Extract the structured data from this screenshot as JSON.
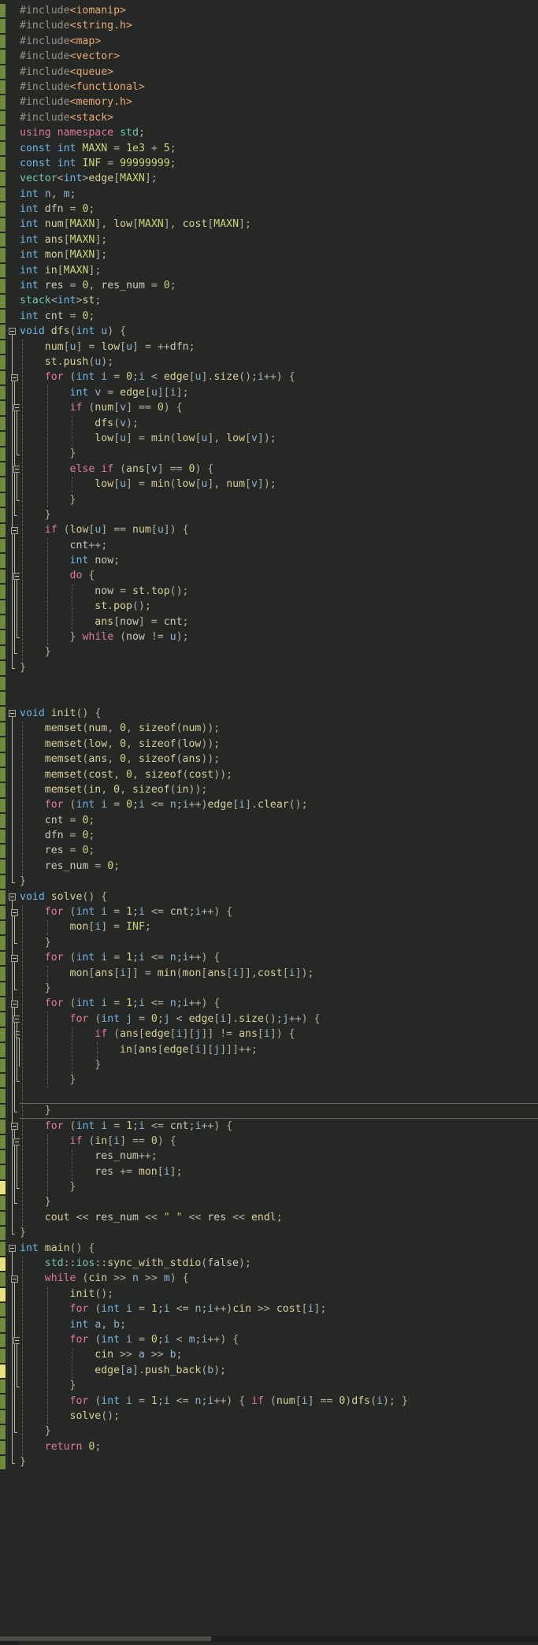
{
  "editor": {
    "name": "code-editor",
    "language": "C++",
    "background_color": "#262826",
    "gutter_color": "#262826",
    "current_line_border_color": "#6a6a64",
    "indent_guide_color": "#5a5c56",
    "change_marker_saved_color": "#6f8a3f",
    "change_marker_unsaved_color": "#e8e07a",
    "current_line_number": 72,
    "total_lines": 107
  },
  "palette": {
    "keyword": "#e0779c",
    "type": "#6fb7e8",
    "preprocessor": "#8f9488",
    "header": "#e8a877",
    "class": "#6fc8a8",
    "function": "#d9cf9a",
    "number": "#c9d67a",
    "string": "#d8c07a",
    "identifier": "#cfc8ba",
    "index": "#8fb4d4",
    "punctuation": "#b4aea2"
  },
  "code": {
    "lines": [
      "#include<iomanip>",
      "#include<string.h>",
      "#include<map>",
      "#include<vector>",
      "#include<queue>",
      "#include<functional>",
      "#include<memory.h>",
      "#include<stack>",
      "using namespace std;",
      "const int MAXN = 1e3 + 5;",
      "const int INF = 99999999;",
      "vector<int>edge[MAXN];",
      "int n, m;",
      "int dfn = 0;",
      "int num[MAXN], low[MAXN], cost[MAXN];",
      "int ans[MAXN];",
      "int mon[MAXN];",
      "int in[MAXN];",
      "int res = 0, res_num = 0;",
      "stack<int>st;",
      "int cnt = 0;",
      "void dfs(int u) {",
      "    num[u] = low[u] = ++dfn;",
      "    st.push(u);",
      "    for (int i = 0;i < edge[u].size();i++) {",
      "        int v = edge[u][i];",
      "        if (num[v] == 0) {",
      "            dfs(v);",
      "            low[u] = min(low[u], low[v]);",
      "        }",
      "        else if (ans[v] == 0) {",
      "            low[u] = min(low[u], num[v]);",
      "        }",
      "    }",
      "    if (low[u] == num[u]) {",
      "        cnt++;",
      "        int now;",
      "        do {",
      "            now = st.top();",
      "            st.pop();",
      "            ans[now] = cnt;",
      "        } while (now != u);",
      "    }",
      "}",
      "",
      "",
      "void init() {",
      "    memset(num, 0, sizeof(num));",
      "    memset(low, 0, sizeof(low));",
      "    memset(ans, 0, sizeof(ans));",
      "    memset(cost, 0, sizeof(cost));",
      "    memset(in, 0, sizeof(in));",
      "    for (int i = 0;i <= n;i++)edge[i].clear();",
      "    cnt = 0;",
      "    dfn = 0;",
      "    res = 0;",
      "    res_num = 0;",
      "}",
      "void solve() {",
      "    for (int i = 1;i <= cnt;i++) {",
      "        mon[i] = INF;",
      "    }",
      "    for (int i = 1;i <= n;i++) {",
      "        mon[ans[i]] = min(mon[ans[i]],cost[i]);",
      "    }",
      "    for (int i = 1;i <= n;i++) {",
      "        for (int j = 0;j < edge[i].size();j++) {",
      "            if (ans[edge[i][j]] != ans[i]) {",
      "                in[ans[edge[i][j]]]++;",
      "            }",
      "        }",
      "",
      "    }",
      "    for (int i = 1;i <= cnt;i++) {",
      "        if (in[i] == 0) {",
      "            res_num++;",
      "            res += mon[i];",
      "        }",
      "    }",
      "    cout << res_num << \" \" << res << endl;",
      "}",
      "int main() {",
      "    std::ios::sync_with_stdio(false);",
      "    while (cin >> n >> m) {",
      "        init();",
      "        for (int i = 1;i <= n;i++)cin >> cost[i];",
      "        int a, b;",
      "        for (int i = 0;i < m;i++) {",
      "            cin >> a >> b;",
      "            edge[a].push_back(b);",
      "        }",
      "        for (int i = 1;i <= n;i++) { if (num[i] == 0)dfs(i); }",
      "        solve();",
      "    }",
      "    return 0;",
      "}"
    ]
  },
  "fold_markers": {
    "collapsible_line_indices": [
      21,
      24,
      26,
      30,
      34,
      37,
      46,
      57,
      61,
      64,
      65,
      66,
      72,
      73,
      80,
      82,
      86
    ]
  },
  "scrollbar": {
    "name": "horizontal-scrollbar",
    "thumb_color": "#4a4c48",
    "track_color": "#1f2120"
  }
}
